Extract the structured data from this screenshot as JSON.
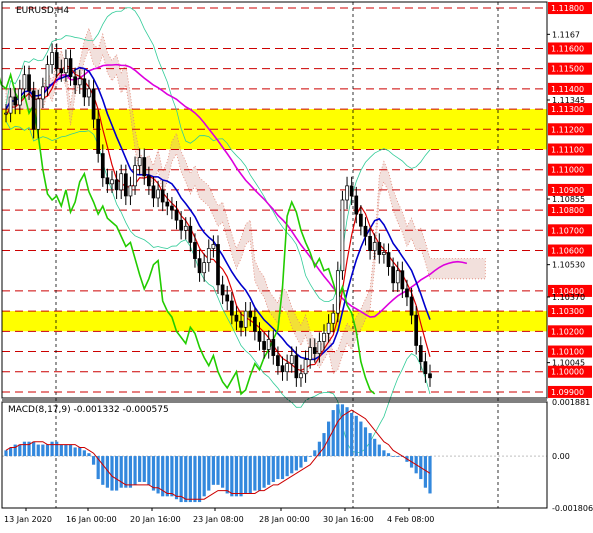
{
  "header": {
    "symbol_label": "EURUSD,H4"
  },
  "macd": {
    "label": "MACD(8,17,9) -0.001332 -0.000575"
  },
  "colors": {
    "background": "#ffffff",
    "level_line": "#cc0000",
    "level_badge": "#ff0000",
    "highlight_zone": "#ffff00",
    "ichimoku_cloud": "#d9a79a",
    "bollinger": "#33cc99",
    "kijun": "#dd00dd",
    "tenkan": "#0000cc",
    "signal_red": "#dd0000",
    "chikou": "#22cc00",
    "macd_hist": "#3388dd",
    "macd_signal": "#cc0000"
  },
  "price_axis": {
    "levels": [
      "1.11800",
      "1.11600",
      "1.11500",
      "1.11400",
      "1.11300",
      "1.11200",
      "1.11100",
      "1.11000",
      "1.10900",
      "1.10800",
      "1.10700",
      "1.10600",
      "1.10400",
      "1.10300",
      "1.10200",
      "1.10100",
      "1.10000",
      "1.09900"
    ],
    "extra_ticks": [
      "1.1167",
      "1.11345",
      "1.10855",
      "1.10530",
      "1.10370",
      "1.10045"
    ],
    "highlighted_zones": [
      [
        "1.11300",
        "1.11100"
      ],
      [
        "1.10300",
        "1.10200"
      ]
    ]
  },
  "macd_axis": {
    "ticks": [
      "0.001881",
      "0.00",
      "-0.001806"
    ]
  },
  "time_axis": {
    "labels": [
      "13 Jan 2020",
      "16 Jan 00:00",
      "20 Jan 16:00",
      "23 Jan 08:00",
      "28 Jan 00:00",
      "30 Jan 16:00",
      "4 Feb 08:00"
    ]
  },
  "chart_data": {
    "type": "candlestick",
    "symbol": "EURUSD",
    "timeframe": "H4",
    "y_range": [
      1.0987,
      1.1183
    ],
    "horizontal_levels": [
      1.118,
      1.116,
      1.115,
      1.114,
      1.113,
      1.112,
      1.111,
      1.11,
      1.109,
      1.108,
      1.107,
      1.106,
      1.104,
      1.103,
      1.102,
      1.101,
      1.1,
      1.099
    ],
    "support_resistance_zones": [
      [
        1.111,
        1.113
      ],
      [
        1.102,
        1.103
      ]
    ],
    "close": [
      1.1128,
      1.1136,
      1.1132,
      1.114,
      1.1147,
      1.1139,
      1.112,
      1.1135,
      1.1141,
      1.1152,
      1.1158,
      1.115,
      1.1148,
      1.1155,
      1.1146,
      1.1142,
      1.1145,
      1.1136,
      1.114,
      1.1125,
      1.1108,
      1.1096,
      1.1093,
      1.1095,
      1.109,
      1.1098,
      1.1087,
      1.1092,
      1.1102,
      1.1106,
      1.1097,
      1.1092,
      1.1086,
      1.109,
      1.1084,
      1.1082,
      1.108,
      1.1075,
      1.107,
      1.1072,
      1.1064,
      1.1056,
      1.1049,
      1.1054,
      1.1061,
      1.1063,
      1.1043,
      1.1038,
      1.1035,
      1.1028,
      1.1025,
      1.1022,
      1.103,
      1.1027,
      1.102,
      1.1015,
      1.1011,
      1.1016,
      1.1008,
      1.1003,
      1.1,
      1.1004,
      1.1008,
      1.0997,
      1.0999,
      1.1006,
      1.1012,
      1.1009,
      1.1015,
      1.1019,
      1.1024,
      1.1029,
      1.105,
      1.1085,
      1.1092,
      1.1087,
      1.1078,
      1.1072,
      1.1067,
      1.106,
      1.1064,
      1.1058,
      1.1059,
      1.1052,
      1.1044,
      1.105,
      1.1041,
      1.1037,
      1.1028,
      1.1013,
      1.1005,
      1.0999,
      1.0997
    ],
    "macd_histogram": [
      0.0002,
      0.0003,
      0.0004,
      0.0004,
      0.0005,
      0.0005,
      0.0005,
      0.0004,
      0.0004,
      0.0004,
      0.0005,
      0.0005,
      0.0004,
      0.0004,
      0.0004,
      0.0003,
      0.0003,
      0.0002,
      0.0001,
      -0.0003,
      -0.0008,
      -0.001,
      -0.0011,
      -0.0012,
      -0.0012,
      -0.0011,
      -0.0011,
      -0.0011,
      -0.001,
      -0.0009,
      -0.0009,
      -0.001,
      -0.0012,
      -0.0013,
      -0.0014,
      -0.0014,
      -0.0014,
      -0.0015,
      -0.0016,
      -0.0016,
      -0.0016,
      -0.0016,
      -0.0016,
      -0.0014,
      -0.0012,
      -0.001,
      -0.001,
      -0.0011,
      -0.0013,
      -0.0014,
      -0.0014,
      -0.0014,
      -0.0013,
      -0.0013,
      -0.0012,
      -0.0012,
      -0.0011,
      -0.001,
      -0.0009,
      -0.0008,
      -0.0008,
      -0.0007,
      -0.0006,
      -0.0005,
      -0.0004,
      -0.0002,
      0.0,
      0.0002,
      0.0005,
      0.0008,
      0.0012,
      0.0016,
      0.0018,
      0.0018,
      0.0017,
      0.0015,
      0.0014,
      0.0012,
      0.001,
      0.0008,
      0.0006,
      0.0004,
      0.0002,
      0.0001,
      0.0,
      0.0,
      0.0,
      -0.0002,
      -0.0004,
      -0.0006,
      -0.0008,
      -0.0011,
      -0.0013
    ],
    "macd_signal": [
      0.0002,
      0.0003,
      0.0003,
      0.0004,
      0.0004,
      0.0004,
      0.0005,
      0.0005,
      0.0005,
      0.0004,
      0.0004,
      0.0004,
      0.0004,
      0.0004,
      0.0004,
      0.0004,
      0.0003,
      0.0003,
      0.0002,
      0.0001,
      -0.0001,
      -0.0003,
      -0.0005,
      -0.0007,
      -0.0008,
      -0.0009,
      -0.001,
      -0.001,
      -0.001,
      -0.001,
      -0.001,
      -0.001,
      -0.0011,
      -0.0011,
      -0.0012,
      -0.0013,
      -0.0013,
      -0.0014,
      -0.0014,
      -0.0015,
      -0.0015,
      -0.0015,
      -0.0015,
      -0.0015,
      -0.0014,
      -0.0013,
      -0.0012,
      -0.0012,
      -0.0012,
      -0.0013,
      -0.0013,
      -0.0013,
      -0.0013,
      -0.0013,
      -0.0013,
      -0.0012,
      -0.0012,
      -0.0011,
      -0.001,
      -0.001,
      -0.0009,
      -0.0008,
      -0.0007,
      -0.0006,
      -0.0005,
      -0.0004,
      -0.0003,
      -0.0001,
      0.0001,
      0.0003,
      0.0006,
      0.0009,
      0.0012,
      0.0014,
      0.0015,
      0.0016,
      0.0015,
      0.0014,
      0.0013,
      0.0011,
      0.0009,
      0.0007,
      0.0005,
      0.0004,
      0.0002,
      0.0001,
      0.0,
      -0.0001,
      -0.0002,
      -0.0003,
      -0.0004,
      -0.0005,
      -0.0006
    ],
    "macd_range": [
      -0.001806,
      0.001881
    ]
  }
}
